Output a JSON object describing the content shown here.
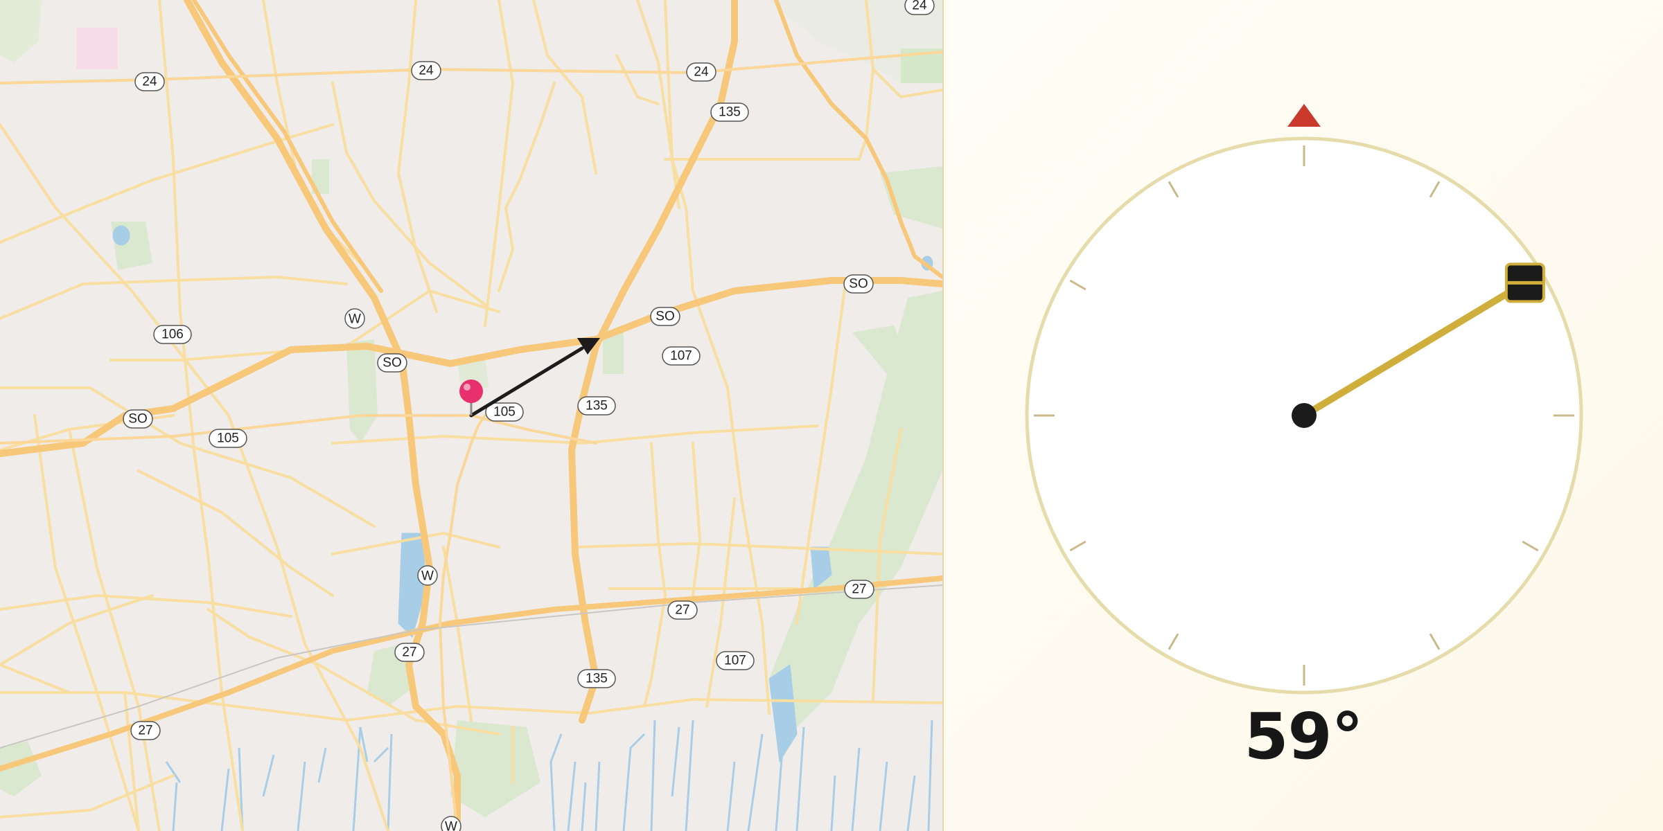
{
  "compass": {
    "heading_deg": 59,
    "heading_label": "59°",
    "needle_color": "#cfae3c",
    "north_marker_color": "#c9392c",
    "dial_stroke_color": "#e6dcab",
    "hub_color": "#1b1b1b"
  },
  "map": {
    "pin_color": "#e8306e",
    "route_labels": [
      {
        "id": "r24a",
        "text": "24"
      },
      {
        "id": "r24b",
        "text": "24"
      },
      {
        "id": "r24c",
        "text": "24"
      },
      {
        "id": "r24d",
        "text": "24"
      },
      {
        "id": "r135a",
        "text": "135"
      },
      {
        "id": "r135b",
        "text": "135"
      },
      {
        "id": "r135c",
        "text": "135"
      },
      {
        "id": "rWa",
        "text": "W"
      },
      {
        "id": "rWb",
        "text": "W"
      },
      {
        "id": "rWc",
        "text": "W"
      },
      {
        "id": "rSOa",
        "text": "SO"
      },
      {
        "id": "rSOb",
        "text": "SO"
      },
      {
        "id": "rSOc",
        "text": "SO"
      },
      {
        "id": "rSOd",
        "text": "SO"
      },
      {
        "id": "r106",
        "text": "106"
      },
      {
        "id": "r105a",
        "text": "105"
      },
      {
        "id": "r105b",
        "text": "105"
      },
      {
        "id": "r107a",
        "text": "107"
      },
      {
        "id": "r107b",
        "text": "107"
      },
      {
        "id": "r27a",
        "text": "27"
      },
      {
        "id": "r27b",
        "text": "27"
      },
      {
        "id": "r27c",
        "text": "27"
      },
      {
        "id": "r27d",
        "text": "27"
      }
    ]
  }
}
